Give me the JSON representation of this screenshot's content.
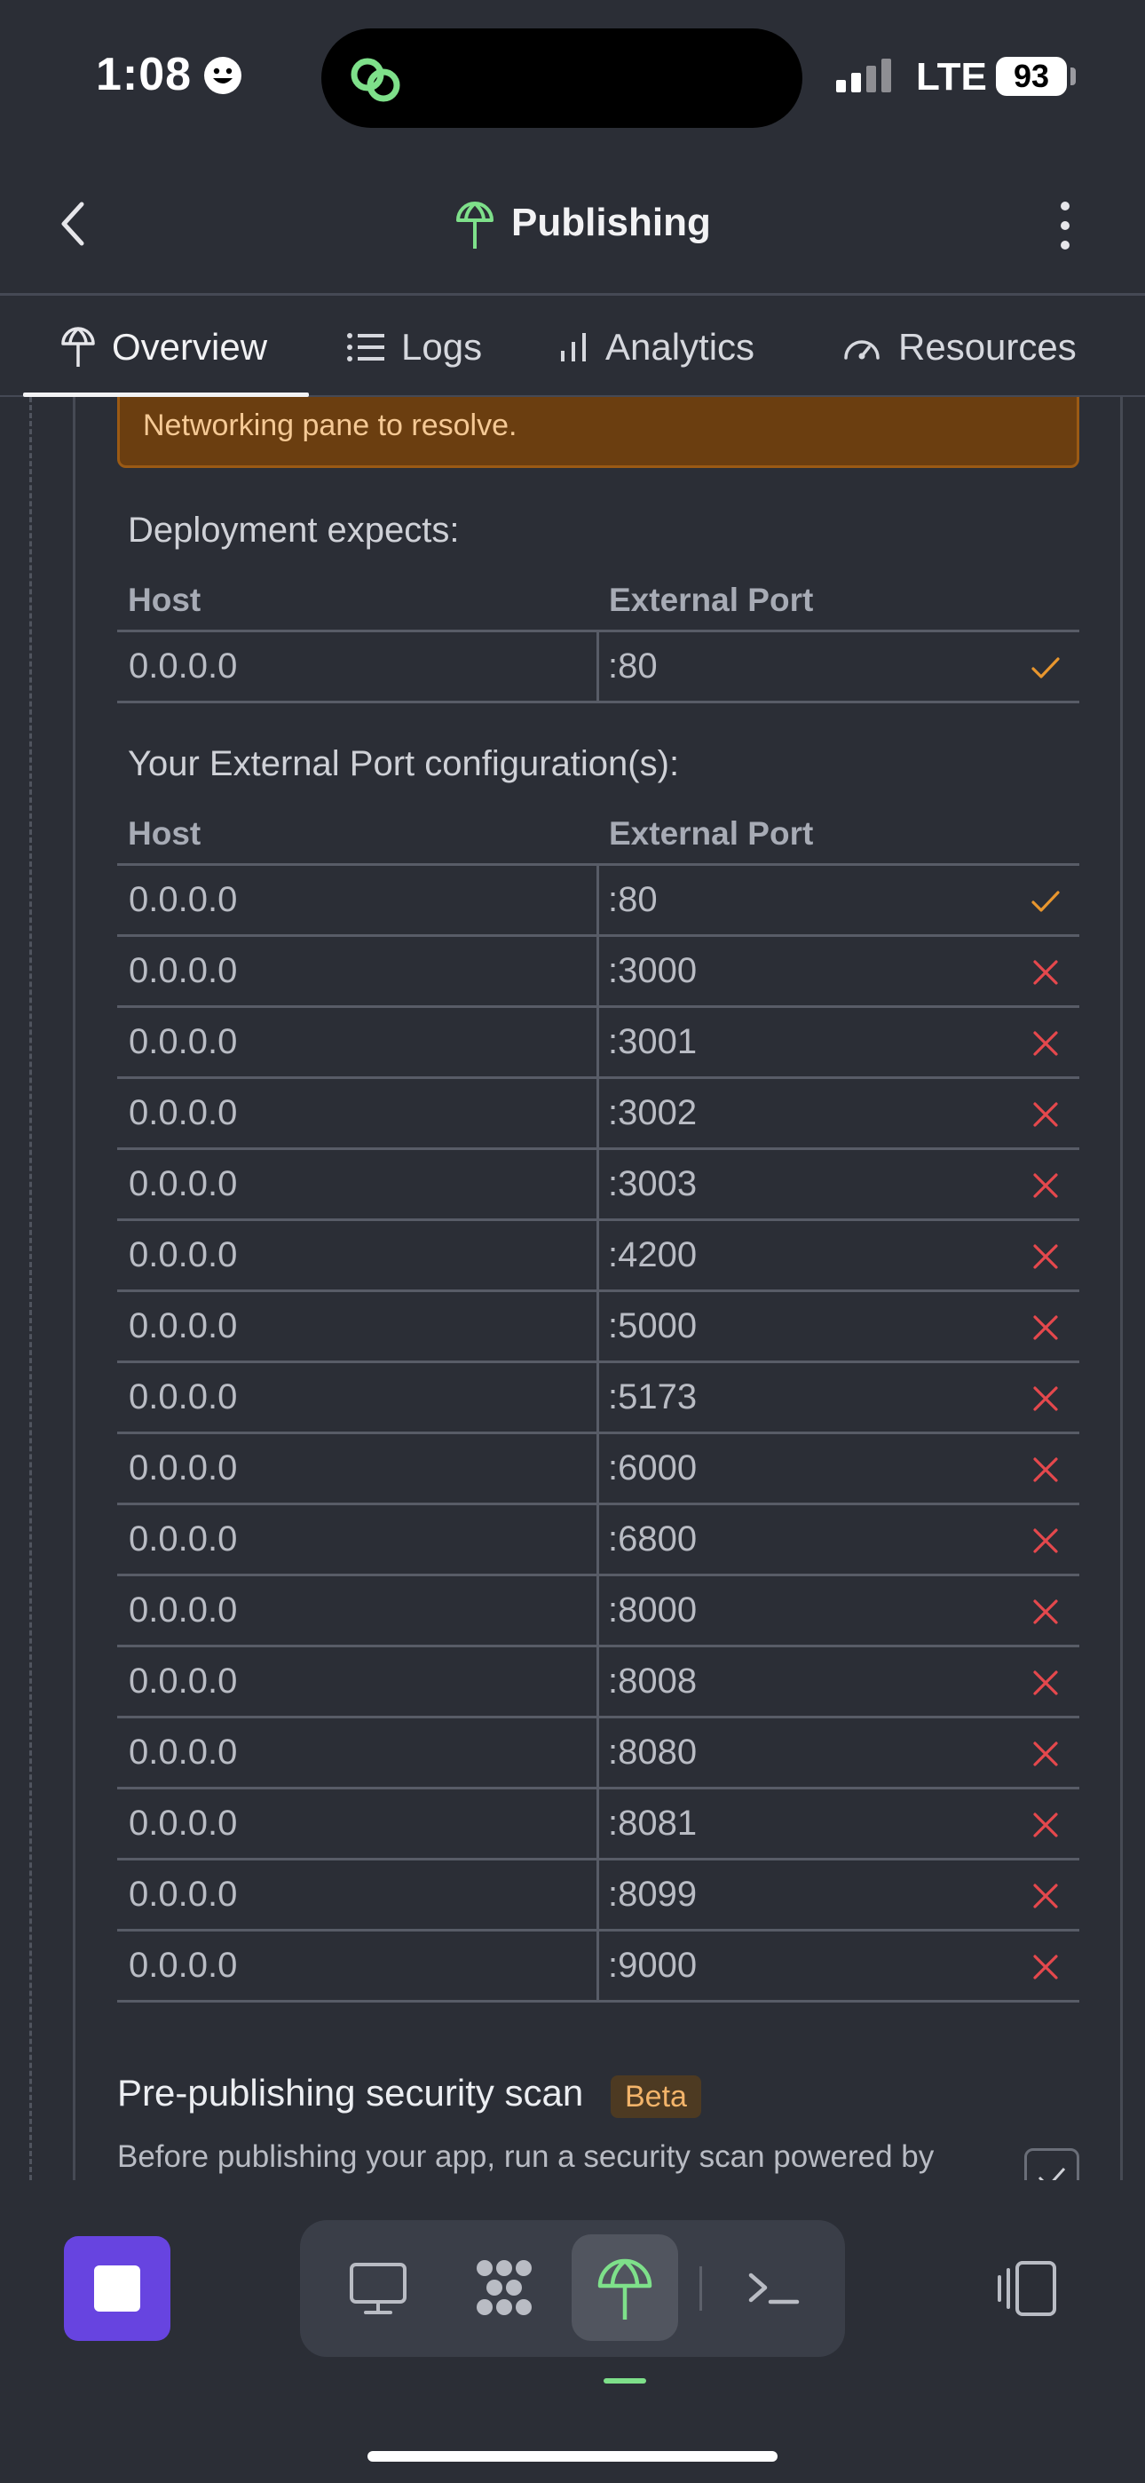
{
  "status_bar": {
    "time": "1:08",
    "network": "LTE",
    "battery": "93"
  },
  "header": {
    "title": "Publishing"
  },
  "tabs": [
    {
      "label": "Overview",
      "icon": "publish-icon",
      "active": true
    },
    {
      "label": "Logs",
      "icon": "list-icon"
    },
    {
      "label": "Analytics",
      "icon": "bar-chart-icon"
    },
    {
      "label": "Resources",
      "icon": "gauge-icon"
    }
  ],
  "warning": {
    "text": "Networking pane to resolve."
  },
  "deployment": {
    "heading": "Deployment expects:",
    "col_host": "Host",
    "col_port": "External Port",
    "rows": [
      {
        "host": "0.0.0.0",
        "port": ":80",
        "status": "ok"
      }
    ]
  },
  "config": {
    "heading": "Your External Port configuration(s):",
    "col_host": "Host",
    "col_port": "External Port",
    "rows": [
      {
        "host": "0.0.0.0",
        "port": ":80",
        "status": "ok"
      },
      {
        "host": "0.0.0.0",
        "port": ":3000",
        "status": "error"
      },
      {
        "host": "0.0.0.0",
        "port": ":3001",
        "status": "error"
      },
      {
        "host": "0.0.0.0",
        "port": ":3002",
        "status": "error"
      },
      {
        "host": "0.0.0.0",
        "port": ":3003",
        "status": "error"
      },
      {
        "host": "0.0.0.0",
        "port": ":4200",
        "status": "error"
      },
      {
        "host": "0.0.0.0",
        "port": ":5000",
        "status": "error"
      },
      {
        "host": "0.0.0.0",
        "port": ":5173",
        "status": "error"
      },
      {
        "host": "0.0.0.0",
        "port": ":6000",
        "status": "error"
      },
      {
        "host": "0.0.0.0",
        "port": ":6800",
        "status": "error"
      },
      {
        "host": "0.0.0.0",
        "port": ":8000",
        "status": "error"
      },
      {
        "host": "0.0.0.0",
        "port": ":8008",
        "status": "error"
      },
      {
        "host": "0.0.0.0",
        "port": ":8080",
        "status": "error"
      },
      {
        "host": "0.0.0.0",
        "port": ":8081",
        "status": "error"
      },
      {
        "host": "0.0.0.0",
        "port": ":8099",
        "status": "error"
      },
      {
        "host": "0.0.0.0",
        "port": ":9000",
        "status": "error"
      }
    ]
  },
  "security_scan": {
    "title": "Pre-publishing security scan",
    "badge": "Beta",
    "description": "Before publishing your app, run a security scan powered by"
  },
  "colors": {
    "ok": "#e8962e",
    "error": "#e5484d",
    "accent": "#6744e0",
    "active_indicator": "#7ee08a"
  }
}
